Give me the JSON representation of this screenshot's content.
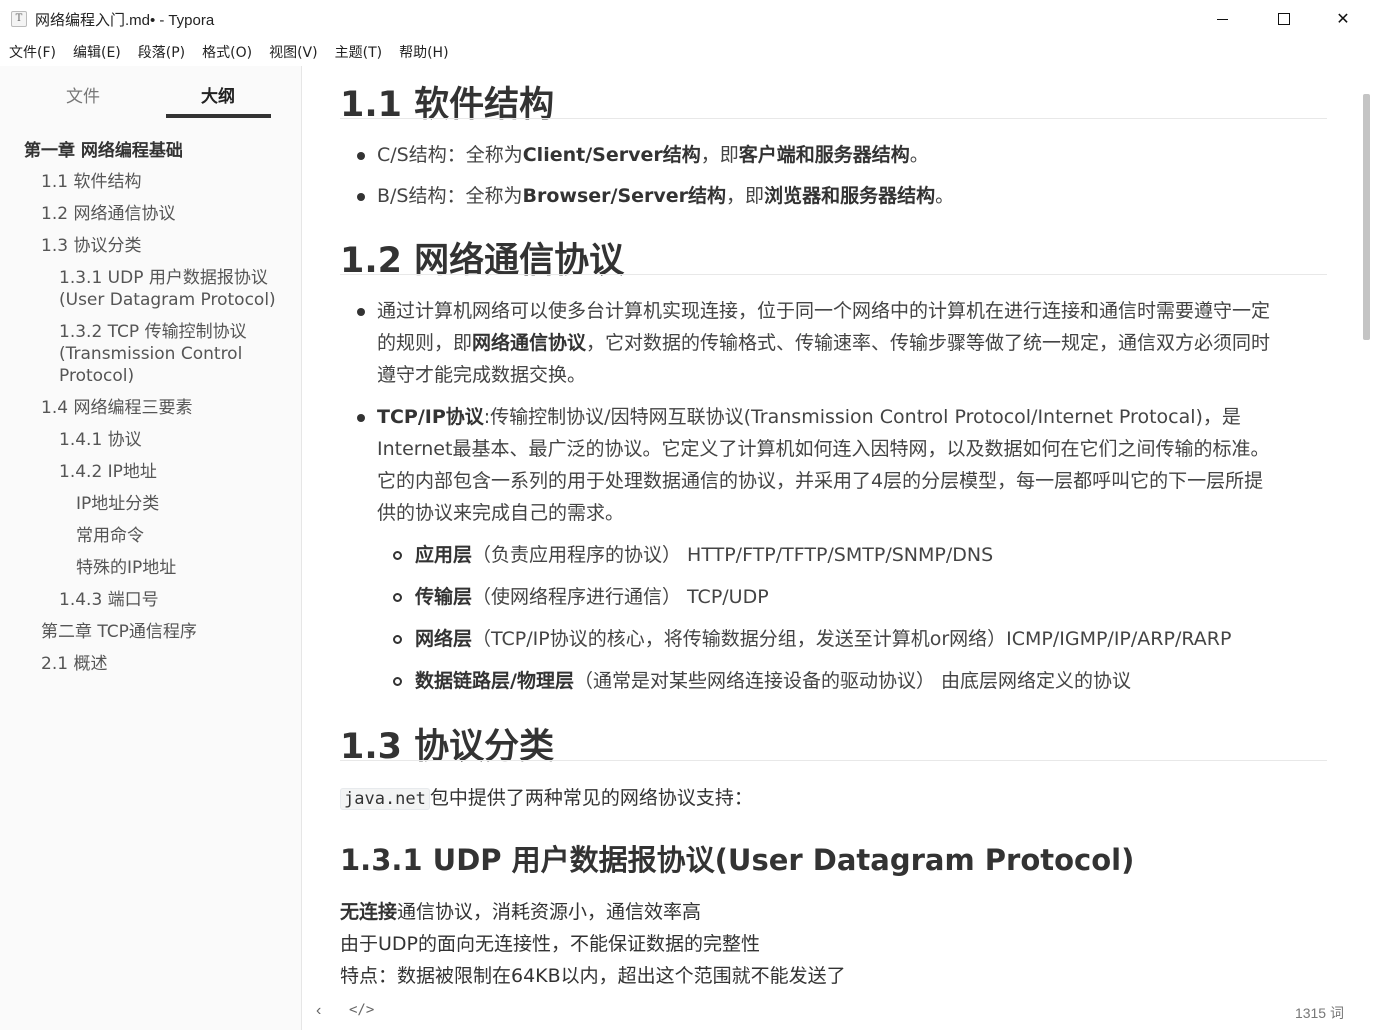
{
  "window": {
    "title": "网络编程入门.md• - Typora",
    "app_icon": "T"
  },
  "menu": [
    "文件(F)",
    "编辑(E)",
    "段落(P)",
    "格式(O)",
    "视图(V)",
    "主题(T)",
    "帮助(H)"
  ],
  "sidebar": {
    "tabs": {
      "files": "文件",
      "outline": "大纲"
    },
    "outline": [
      "第一章 网络编程基础",
      "1.1 软件结构",
      "1.2 网络通信协议",
      "1.3 协议分类",
      "1.3.1 UDP 用户数据报协议\n(User Datagram Protocol)",
      "1.3.2 TCP 传输控制协议\n(Transmission Control\nProtocol)",
      "1.4 网络编程三要素",
      "1.4.1 协议",
      "1.4.2 IP地址",
      "IP地址分类",
      "常用命令",
      "特殊的IP地址",
      "1.4.3 端口号",
      "第二章 TCP通信程序",
      "2.1 概述"
    ]
  },
  "content": {
    "h_1_1": "1.1 软件结构",
    "cs": {
      "a": "C/S结构：全称为",
      "b": "Client/Server结构",
      "c": "，即",
      "d": "客户端和服务器结构",
      "e": "。"
    },
    "bs": {
      "a": "B/S结构：全称为",
      "b": "Browser/Server结构",
      "c": "，即",
      "d": "浏览器和服务器结构",
      "e": "。"
    },
    "h_1_2": "1.2 网络通信协议",
    "p_net": {
      "l1": "通过计算机网络可以使多台计算机实现连接，位于同一个网络中的计算机在进行连接和通信时需要遵守一定",
      "l2a": "的规则，即",
      "l2b": "网络通信协议",
      "l2c": "，它对数据的传输格式、传输速率、传输步骤等做了统一规定，通信双方必须同时",
      "l3": "遵守才能完成数据交换。"
    },
    "p_tcpip": {
      "b": "TCP/IP协议",
      "l1": ":传输控制协议/因特网互联协议(Transmission Control Protocol/Internet Protocal)，是",
      "l2": "Internet最基本、最广泛的协议。它定义了计算机如何连入因特网，以及数据如何在它们之间传输的标准。",
      "l3": "它的内部包含一系列的用于处理数据通信的协议，并采用了4层的分层模型，每一层都呼叫它的下一层所提",
      "l4": "供的协议来完成自己的需求。"
    },
    "layers": [
      {
        "name": "应用层",
        "desc": "（负责应用程序的协议） HTTP/FTP/TFTP/SMTP/SNMP/DNS"
      },
      {
        "name": "传输层",
        "desc": "（使网络程序进行通信） TCP/UDP"
      },
      {
        "name": "网络层",
        "desc": "（TCP/IP协议的核心，将传输数据分组，发送至计算机or网络）ICMP/IGMP/IP/ARP/RARP"
      },
      {
        "name": "数据链路层/物理层",
        "desc": "（通常是对某些网络连接设备的驱动协议） 由底层网络定义的协议"
      }
    ],
    "h_1_3": "1.3 协议分类",
    "javanet": {
      "code": "java.net",
      "text": "包中提供了两种常见的网络协议支持："
    },
    "h_1_3_1": "1.3.1 UDP 用户数据报协议(User Datagram Protocol)",
    "udp": {
      "l1b": "无连接",
      "l1": "通信协议，消耗资源小，通信效率高",
      "l2": "由于UDP的面向无连接性，不能保证数据的完整性",
      "l3": "特点：数据被限制在64KB以内，超出这个范围就不能发送了"
    }
  },
  "footer": {
    "word_count": "1315 词"
  }
}
